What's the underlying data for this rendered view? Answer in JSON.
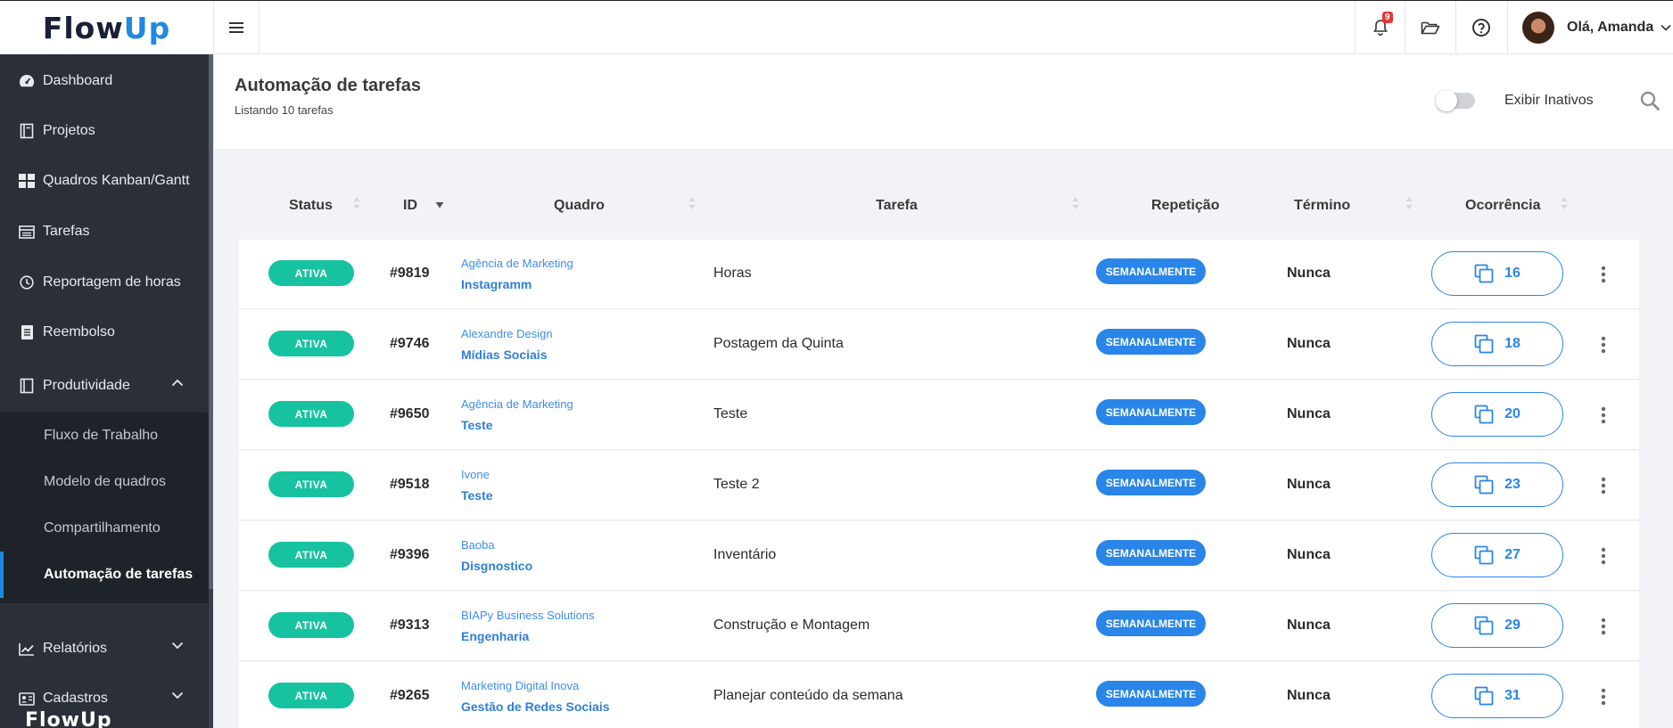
{
  "brand": {
    "logo_main": "Flow",
    "logo_accent": "Up",
    "footer_logo": "FlowUp"
  },
  "topbar": {
    "notification_count": "9",
    "user_greeting": "Olá, Amanda"
  },
  "sidebar": {
    "items": [
      {
        "label": "Dashboard"
      },
      {
        "label": "Projetos"
      },
      {
        "label": "Quadros Kanban/Gantt"
      },
      {
        "label": "Tarefas"
      },
      {
        "label": "Reportagem de horas"
      },
      {
        "label": "Reembolso"
      },
      {
        "label": "Produtividade"
      },
      {
        "label": "Relatórios"
      },
      {
        "label": "Cadastros"
      }
    ],
    "subitems": [
      {
        "label": "Fluxo de Trabalho"
      },
      {
        "label": "Modelo de quadros"
      },
      {
        "label": "Compartilhamento"
      },
      {
        "label": "Automação de tarefas"
      }
    ]
  },
  "page": {
    "title": "Automação de tarefas",
    "subtitle": "Listando 10 tarefas",
    "toggle_label": "Exibir Inativos"
  },
  "table": {
    "headers": [
      "Status",
      "ID",
      "Quadro",
      "Tarefa",
      "Repetição",
      "Término",
      "Ocorrência"
    ],
    "rows": [
      {
        "status": "ATIVA",
        "id": "#9819",
        "client": "Agência de Marketing",
        "board": "Instagramm",
        "task": "Horas",
        "repeat": "SEMANALMENTE",
        "end": "Nunca",
        "occurrences": "16"
      },
      {
        "status": "ATIVA",
        "id": "#9746",
        "client": "Alexandre Design",
        "board": "Mídias Sociais",
        "task": "Postagem da Quinta",
        "repeat": "SEMANALMENTE",
        "end": "Nunca",
        "occurrences": "18"
      },
      {
        "status": "ATIVA",
        "id": "#9650",
        "client": "Agência de Marketing",
        "board": "Teste",
        "task": "Teste",
        "repeat": "SEMANALMENTE",
        "end": "Nunca",
        "occurrences": "20"
      },
      {
        "status": "ATIVA",
        "id": "#9518",
        "client": "Ivone",
        "board": "Teste",
        "task": "Teste 2",
        "repeat": "SEMANALMENTE",
        "end": "Nunca",
        "occurrences": "23"
      },
      {
        "status": "ATIVA",
        "id": "#9396",
        "client": "Baoba",
        "board": "Disgnostico",
        "task": "Inventário",
        "repeat": "SEMANALMENTE",
        "end": "Nunca",
        "occurrences": "27"
      },
      {
        "status": "ATIVA",
        "id": "#9313",
        "client": "BIAPy Business Solutions",
        "board": "Engenharia",
        "task": "Construção e Montagem",
        "repeat": "SEMANALMENTE",
        "end": "Nunca",
        "occurrences": "29"
      },
      {
        "status": "ATIVA",
        "id": "#9265",
        "client": "Marketing Digital Inova",
        "board": "Gestão de Redes Sociais",
        "task": "Planejar conteúdo da semana",
        "repeat": "SEMANALMENTE",
        "end": "Nunca",
        "occurrences": "31"
      }
    ]
  },
  "colors": {
    "sidebar_bg": "#2b3038",
    "submenu_bg": "#1e2329",
    "accent_blue": "#2a85e8",
    "status_green": "#17c2a0",
    "badge_red": "#e53935"
  },
  "icons": {
    "menu": "hamburger-icon",
    "notifications": "bell-icon",
    "folder": "folder-open-icon",
    "help": "question-circle-icon",
    "search": "search-icon",
    "occurrence": "copy-icon",
    "row_actions": "kebab-icon"
  }
}
